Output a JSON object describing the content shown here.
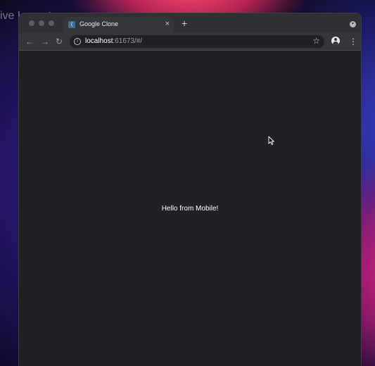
{
  "background_label": "ive Layout",
  "browser": {
    "tab": {
      "title": "Google Clone",
      "close_glyph": "×",
      "favicon_glyph": "⟨"
    },
    "new_tab_glyph": "+",
    "tab_menu_glyph": "▾",
    "toolbar": {
      "back_glyph": "←",
      "forward_glyph": "→",
      "reload_glyph": "↻",
      "info_glyph": "i",
      "url_host": "localhost",
      "url_rest": ":61673/#/",
      "star_glyph": "☆",
      "more_glyph": "⋮"
    }
  },
  "page": {
    "message": "Hello from Mobile!"
  },
  "colors": {
    "window_bg": "#202124",
    "tabstrip_bg": "#2f3033",
    "toolbar_bg": "#35363a",
    "text": "#ffffff"
  }
}
